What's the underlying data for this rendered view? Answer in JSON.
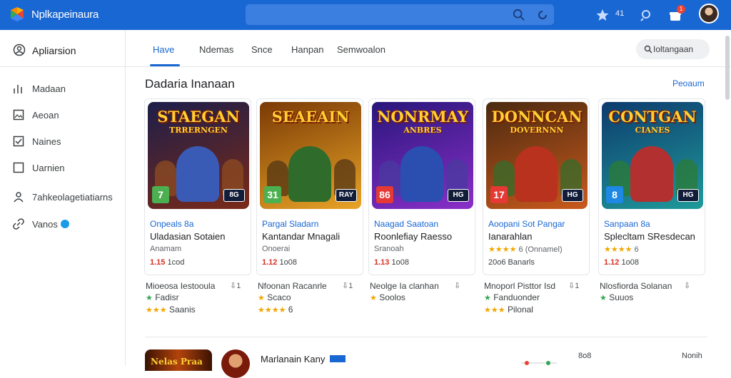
{
  "topbar": {
    "title": "Nplkapeinaura",
    "notif_count": "41",
    "badge": "1",
    "logo_icon": "store-logo-icon",
    "colors": {
      "bar": "#1967d2",
      "search": "#3b7fe0"
    }
  },
  "sidebar": {
    "header": {
      "label": "Apliarsion",
      "icon": "user-circle-icon"
    },
    "items": [
      {
        "label": "Madaan",
        "icon": "bar-chart-icon"
      },
      {
        "label": "Aeoan",
        "icon": "image-icon"
      },
      {
        "label": "Naines",
        "icon": "check-box-icon"
      },
      {
        "label": "Uarnien",
        "icon": "square-icon"
      },
      {
        "label": "7ahkeolagetiatiarns",
        "icon": "person-icon"
      },
      {
        "label": "Vanos",
        "icon": "link-icon"
      }
    ]
  },
  "tabs": [
    {
      "label": "Have",
      "active": true
    },
    {
      "label": "Ndemas"
    },
    {
      "label": "Snce"
    },
    {
      "label": "Hanpan"
    },
    {
      "label": "Semwoalon"
    }
  ],
  "filter_pill": {
    "label": "Ioltangaan"
  },
  "section": {
    "title": "Dadaria Inanaan",
    "see_more": "Peoaum"
  },
  "cards": [
    {
      "title": "STAEGAN",
      "subtitle": "TRRERNGEN",
      "age": "7",
      "rating_tag": "8G",
      "dev": "Onpeals 8a",
      "name": "Uladasian Sotaien",
      "meta": "Anamam",
      "price_red": "1.15",
      "price_rest": "1cod",
      "stars": "",
      "theme": {
        "bg1": "#1d1e4a",
        "bg2": "#7a2a18",
        "hero": "#3a5bb5",
        "fig": "#8b4a22",
        "age_bg": "#4caf50"
      }
    },
    {
      "title": "SEAEAIN",
      "subtitle": "",
      "age": "31",
      "rating_tag": "RAY",
      "dev": "Pargal Sladarn",
      "name": "Kantandar Mnagali",
      "meta": "Onoerai",
      "price_red": "1.12",
      "price_rest": "1o08",
      "stars": "",
      "theme": {
        "bg1": "#7a3a06",
        "bg2": "#e8a326",
        "hero": "#2f6b2a",
        "fig": "#5a3a14",
        "age_bg": "#4caf50"
      }
    },
    {
      "title": "NONRMAY",
      "subtitle": "ANBRES",
      "age": "86",
      "rating_tag": "HG",
      "dev": "Naagad Saatoan",
      "name": "Roonlefiay Raesso",
      "meta": "Sranoah",
      "price_red": "1.13",
      "price_rest": "1o08",
      "stars": "",
      "theme": {
        "bg1": "#28167a",
        "bg2": "#8a2fc9",
        "hero": "#2a4fb0",
        "fig": "#4a3aa0",
        "age_bg": "#e53935"
      }
    },
    {
      "title": "DONNCAN",
      "subtitle": "DOVERNNN",
      "age": "17",
      "rating_tag": "HG",
      "dev": "Aoopani Sot Pangar",
      "name": "Ianarahlan",
      "meta": "6 (Onnamel)",
      "price_red": "",
      "price_rest": "20o6 Banarls",
      "stars": "★★★★",
      "theme": {
        "bg1": "#4a2a10",
        "bg2": "#c9591c",
        "hero": "#b8321e",
        "fig": "#3a6a2a",
        "age_bg": "#e53935"
      }
    },
    {
      "title": "CONTGAN",
      "subtitle": "CIANES",
      "age": "8",
      "rating_tag": "HG",
      "dev": "Sanpaan 8a",
      "name": "Splecltam SResdecan",
      "meta": "6",
      "price_red": "1.12",
      "price_rest": "1o08",
      "stars": "★★★★",
      "theme": {
        "bg1": "#0d3b6e",
        "bg2": "#1f9a9a",
        "hero": "#b33030",
        "fig": "#2a7a3a",
        "age_bg": "#1e88e5"
      }
    }
  ],
  "below": [
    {
      "line1": "Mioeosa Iestooula",
      "dl": "1",
      "line2": "Fadisr",
      "line3": "Saanis",
      "stars3": "★★★",
      "leaf": true
    },
    {
      "line1": "Nfoonan Racanrle",
      "dl": "1",
      "line2": "Scaco",
      "line3": "6",
      "stars2": "★",
      "stars3": "★★★★",
      "leaf": false
    },
    {
      "line1": "Neolge Ia clanhan",
      "dl": "",
      "line2": "Soolos",
      "line3": "",
      "stars2": "★",
      "leaf": false
    },
    {
      "line1": "Mnoporl Pisttor Isd",
      "dl": "1",
      "line2": "Fanduonder",
      "line3": "Pilonal",
      "stars3": "★★★",
      "leaf": true
    },
    {
      "line1": "Nlosfiorda Solanan",
      "dl": "",
      "line2": "Suuos",
      "line3": "",
      "leaf": true
    }
  ],
  "bottom": {
    "thumb_text": "Nelas Praa",
    "name": "Marlanain Kany",
    "num": "8o8",
    "right": "Nonih"
  }
}
